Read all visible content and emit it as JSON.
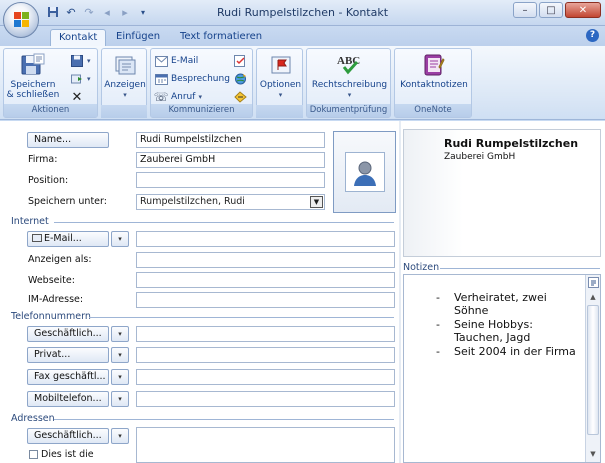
{
  "window": {
    "title": "Rudi Rumpelstilzchen - Kontakt"
  },
  "tabs": [
    {
      "label": "Kontakt"
    },
    {
      "label": "Einfügen"
    },
    {
      "label": "Text formatieren"
    }
  ],
  "ribbon": {
    "aktionen": {
      "save_close_line1": "Speichern",
      "save_close_line2": "& schließen",
      "label": "Aktionen"
    },
    "anzeigen": {
      "label": "Anzeigen"
    },
    "kommunizieren": {
      "email": "E-Mail",
      "meeting": "Besprechung",
      "call": "Anruf",
      "label": "Kommunizieren"
    },
    "optionen": {
      "label": "Optionen"
    },
    "dokumentpruefung": {
      "spelling": "Rechtschreibung",
      "label": "Dokumentprüfung"
    },
    "onenote": {
      "notes": "Kontaktnotizen",
      "label": "OneNote"
    }
  },
  "form": {
    "name_button": "Name...",
    "name_value": "Rudi Rumpelstilzchen",
    "firma_label": "Firma:",
    "firma_value": "Zauberei GmbH",
    "position_label": "Position:",
    "position_value": "",
    "save_as_label": "Speichern unter:",
    "save_as_value": "Rumpelstilzchen, Rudi",
    "internet_section": "Internet",
    "email_button": "E-Mail...",
    "display_as_label": "Anzeigen als:",
    "website_label": "Webseite:",
    "im_label": "IM-Adresse:",
    "phones_section": "Telefonnummern",
    "phone_business": "Geschäftlich...",
    "phone_private": "Privat...",
    "phone_fax": "Fax geschäftl...",
    "phone_mobile": "Mobiltelefon...",
    "address_section": "Adressen",
    "address_business": "Geschäftlich...",
    "address_checkbox": "Dies ist die"
  },
  "card": {
    "name": "Rudi Rumpelstilzchen",
    "company": "Zauberei GmbH"
  },
  "notes": {
    "label": "Notizen",
    "items": [
      "Verheiratet, zwei Söhne",
      "Seine Hobbys: Tauchen, Jagd",
      "Seit 2004 in der Firma"
    ]
  }
}
